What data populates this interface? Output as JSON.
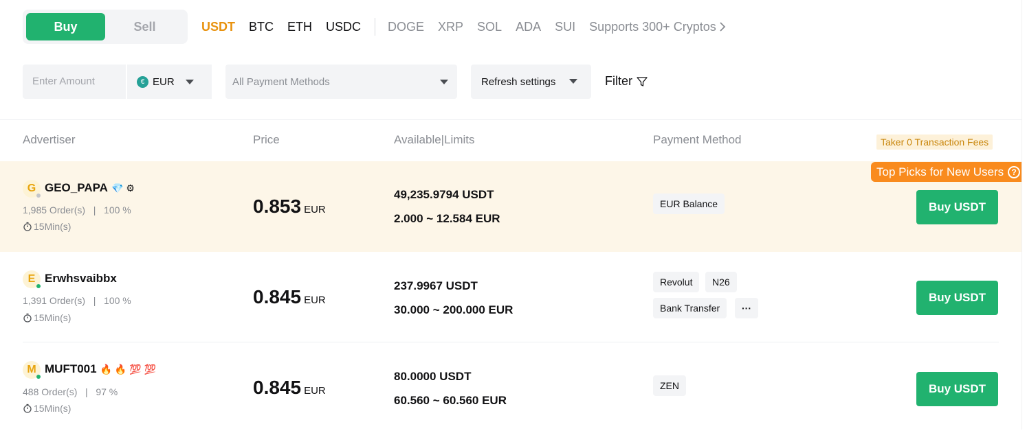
{
  "trade_toggle": {
    "buy": "Buy",
    "sell": "Sell"
  },
  "coins": [
    "USDT",
    "BTC",
    "ETH",
    "USDC"
  ],
  "coins_more": [
    "DOGE",
    "XRP",
    "SOL",
    "ADA",
    "SUI"
  ],
  "supports_link": "Supports 300+ Cryptos",
  "filters": {
    "amount_placeholder": "Enter Amount",
    "currency": "EUR",
    "currency_symbol": "€",
    "payment_placeholder": "All Payment Methods",
    "refresh_label": "Refresh settings",
    "filter_label": "Filter"
  },
  "table": {
    "headers": {
      "advertiser": "Advertiser",
      "price": "Price",
      "available": "Available|Limits",
      "payment": "Payment Method"
    },
    "fees_badge": "Taker 0 Transaction Fees",
    "top_picks": "Top Picks for New Users",
    "rows": [
      {
        "initial": "G",
        "name": "GEO_PAPA",
        "badges": "💎 ⚙",
        "orders": "1,985 Order(s)",
        "completion": "100 %",
        "time": "15Min(s)",
        "price": "0.853",
        "price_unit": "EUR",
        "available": "49,235.9794 USDT",
        "limits": "2.000 ~ 12.584 EUR",
        "payments": [
          "EUR Balance"
        ],
        "button": "Buy USDT"
      },
      {
        "initial": "E",
        "name": "Erwhsvaibbx",
        "badges": "",
        "orders": "1,391 Order(s)",
        "completion": "100 %",
        "time": "15Min(s)",
        "price": "0.845",
        "price_unit": "EUR",
        "available": "237.9967 USDT",
        "limits": "30.000 ~ 200.000 EUR",
        "payments": [
          "Revolut",
          "N26",
          "Bank Transfer",
          "···"
        ],
        "button": "Buy USDT"
      },
      {
        "initial": "M",
        "name": "MUFT001",
        "badges": "🔥 🔥 💯 💯",
        "orders": "488 Order(s)",
        "completion": "97 %",
        "time": "15Min(s)",
        "price": "0.845",
        "price_unit": "EUR",
        "available": "80.0000 USDT",
        "limits": "60.560 ~ 60.560 EUR",
        "payments": [
          "ZEN"
        ],
        "button": "Buy USDT"
      }
    ]
  },
  "colors": {
    "accent_green": "#21b26f",
    "accent_orange": "#e8920e",
    "highlight_row": "#fdf6e8"
  }
}
